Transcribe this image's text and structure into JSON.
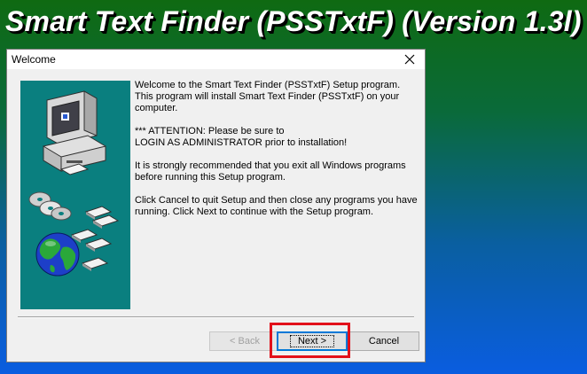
{
  "banner": {
    "title": "Smart Text Finder (PSSTxtF) (Version 1.3l)"
  },
  "dialog": {
    "title": "Welcome",
    "paragraphs": [
      "Welcome to the Smart Text Finder (PSSTxtF) Setup program. This program will install Smart Text Finder (PSSTxtF) on your computer.",
      "*** ATTENTION: Please be sure to\nLOGIN AS ADMINISTRATOR prior to installation!",
      "It is strongly recommended that you exit all Windows programs before running this Setup program.",
      "Click Cancel to quit Setup and then close any programs you have running. Click Next to continue with the Setup program."
    ],
    "buttons": {
      "back": "< Back",
      "next": "Next >",
      "cancel": "Cancel"
    }
  },
  "colors": {
    "illustration_bg": "#0a7f7f",
    "highlight": "#e2101a",
    "accent": "#0078d7"
  },
  "icons": [
    "computer-icon",
    "disc-icon",
    "floppy-icon",
    "globe-icon",
    "close-icon"
  ]
}
